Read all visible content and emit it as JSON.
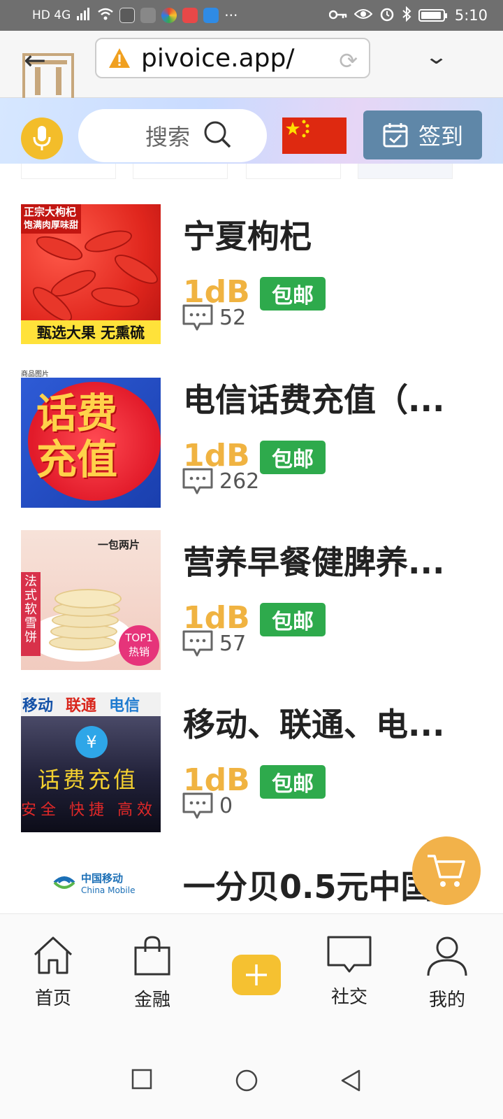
{
  "status_bar": {
    "network_label": "HD 4G",
    "time": "5:10",
    "more": "···"
  },
  "browser": {
    "url": "pivoice.app/",
    "back_symbol": "←",
    "reload_symbol": "⟳",
    "menu_symbol": "⌄"
  },
  "header": {
    "search_placeholder": "搜索",
    "signin_label": "签到",
    "flag": "china-flag"
  },
  "products": [
    {
      "title": "宁夏枸杞",
      "price": "1dB",
      "shipping": "包邮",
      "comments": "52",
      "thumb_tag_line1": "正宗大枸杞",
      "thumb_tag_line2": "饱满肉厚味甜",
      "thumb_footer": "甄选大果 无熏硫"
    },
    {
      "title": "电信话费充值（...",
      "price": "1dB",
      "shipping": "包邮",
      "comments": "262",
      "thumb_small": "商品图片",
      "thumb_text": "话费充值"
    },
    {
      "title": "营养早餐健脾养...",
      "price": "1dB",
      "shipping": "包邮",
      "comments": "57",
      "thumb_pack": "一包两片",
      "thumb_side": "法式软雪饼",
      "thumb_badge": "TOP1 热销"
    },
    {
      "title": "移动、联通、电...",
      "price": "1dB",
      "shipping": "包邮",
      "comments": "0",
      "thumb_carriers": [
        "移动",
        "联通",
        "电信"
      ],
      "thumb_text": "话费充值",
      "thumb_sub": "安全 快捷 高效"
    },
    {
      "title": "一分贝0.5元中国",
      "thumb_logo_cn": "中国移动",
      "thumb_logo_en": "China Mobile"
    }
  ],
  "bottom_nav": {
    "home": "首页",
    "finance": "金融",
    "social": "社交",
    "mine": "我的"
  },
  "colors": {
    "accent_yellow": "#f5c131",
    "price_orange": "#f0b341",
    "shipping_green": "#2eaa4c",
    "signin_blue": "#5f87a8"
  }
}
